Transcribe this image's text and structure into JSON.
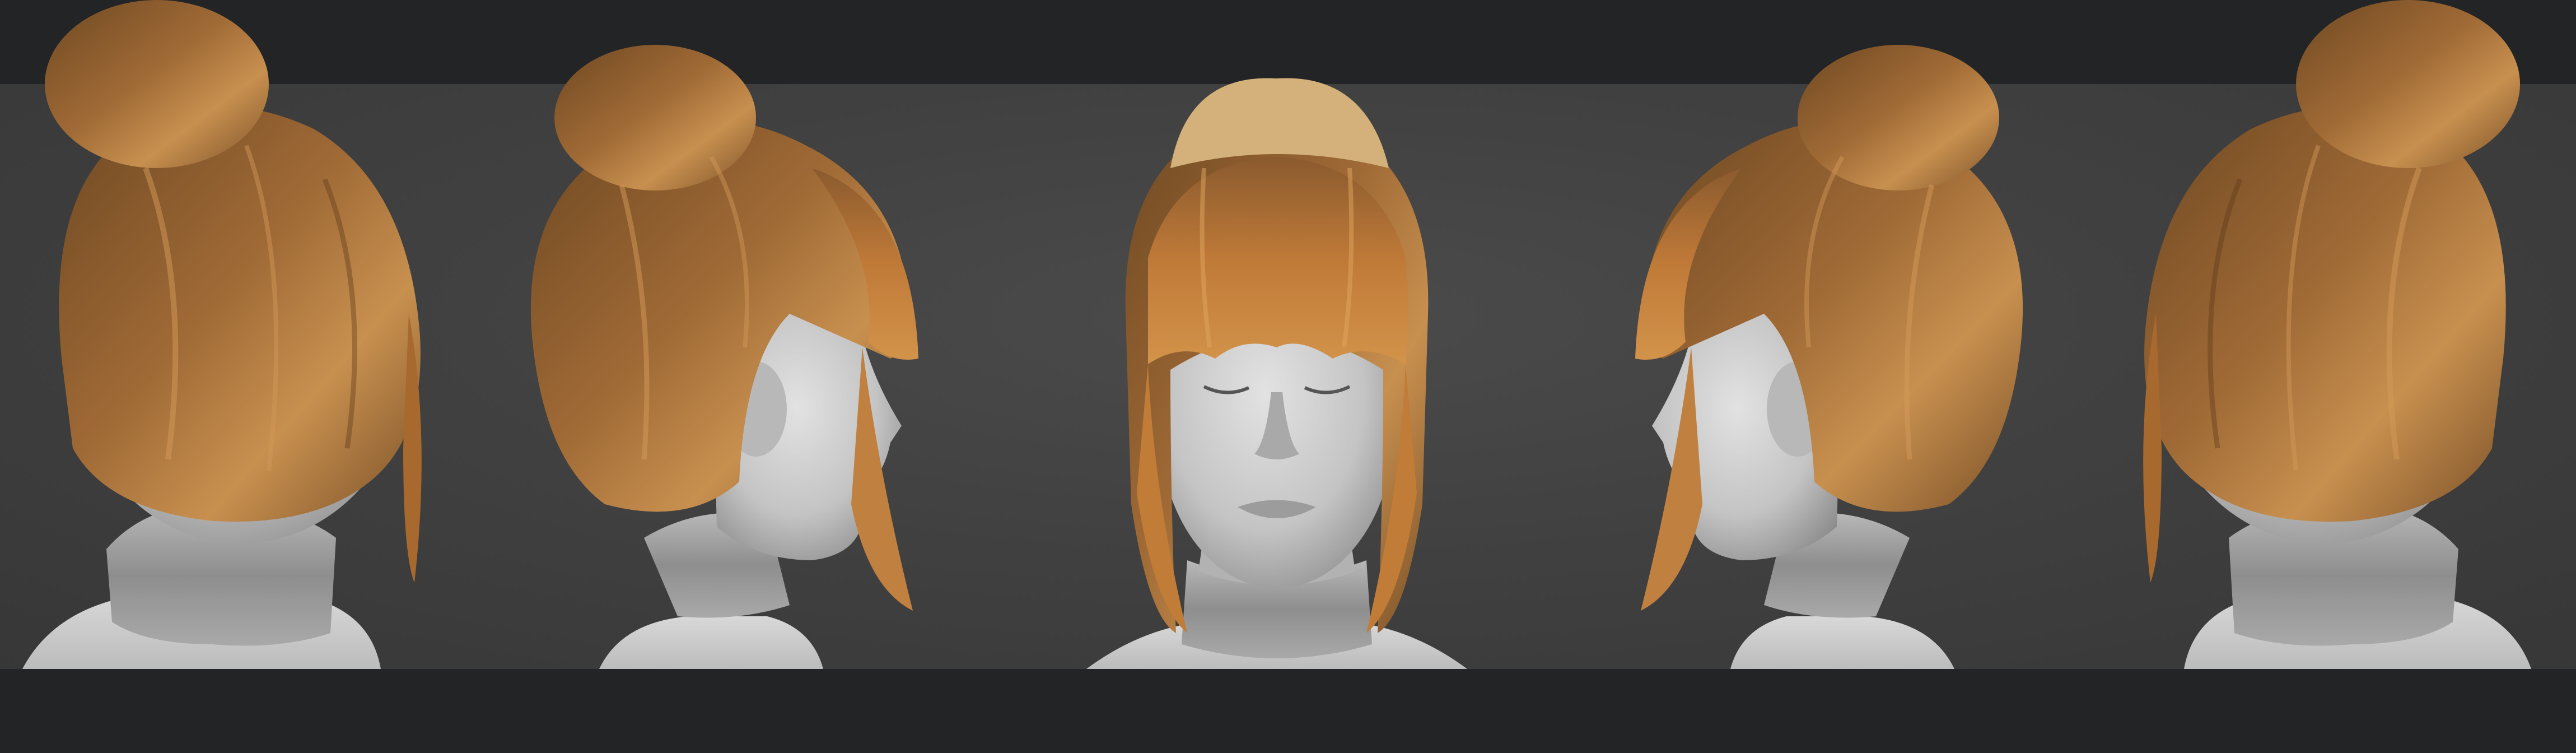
{
  "scene": {
    "views": [
      {
        "id": "left-back"
      },
      {
        "id": "left-profile"
      },
      {
        "id": "front"
      },
      {
        "id": "right-profile"
      },
      {
        "id": "right-back"
      }
    ],
    "colors": {
      "band": "#222425",
      "backdrop": "#414141",
      "skin": "#c9c9c9",
      "hair_base": "#8a5a2e",
      "hair_light": "#c8904f",
      "collar": "#9e9e9e"
    }
  }
}
